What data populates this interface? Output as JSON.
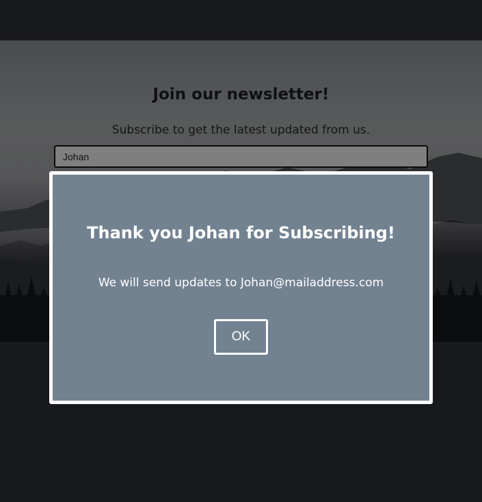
{
  "newsletter": {
    "title": "Join our newsletter!",
    "subtitle": "Subscribe to get the latest updated from us.",
    "name_input_value": "Johan"
  },
  "modal": {
    "title": "Thank you Johan for Subscribing!",
    "message": "We will send updates to Johan@mailaddress.com",
    "ok_label": "OK"
  },
  "colors": {
    "page_background": "#18191c",
    "modal_background": "#738291",
    "modal_border": "#ffffff",
    "input_background": "#7f7f7f"
  }
}
